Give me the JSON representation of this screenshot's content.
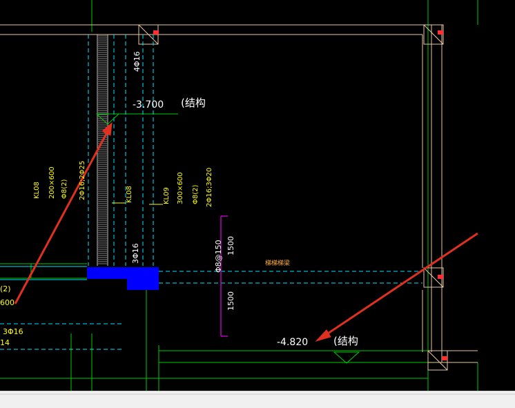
{
  "colors": {
    "background": "#000000",
    "white": "#ffffff",
    "green": "#00cc00",
    "cyan": "#00e5ff",
    "yellow": "#ffff00",
    "orange": "#ffb040",
    "magenta": "#c000c0",
    "red": "#e03020",
    "blue": "#0000ff",
    "beige": "#e8c8a0"
  },
  "annotations": {
    "elevation_top": "-3.700",
    "elevation_top_note": "(结构",
    "elevation_bottom": "-4.820",
    "elevation_bottom_note": "(结构",
    "rebar_top_4": "4Φ16",
    "rebar_bottom_3": "3Φ16",
    "stirrup_vertical": "Φ8@150",
    "dim_upper": "1500",
    "dim_lower": "1500",
    "stair_beam_note": "梯梯梯梁"
  },
  "beams": {
    "kl08_a": {
      "name": "KL08",
      "size": "200×600",
      "stirrup": "Φ8(2)",
      "rebar": "2Φ16;2Φ25"
    },
    "kl08_b": {
      "name": "KL08"
    },
    "kl09": {
      "name": "KL09",
      "size": "300×600",
      "stirrup": "Φ8(2)",
      "rebar": "2Φ16;3Φ20"
    }
  },
  "left_edge_labels": [
    "(2)",
    "600",
    "3Φ16",
    "14"
  ]
}
